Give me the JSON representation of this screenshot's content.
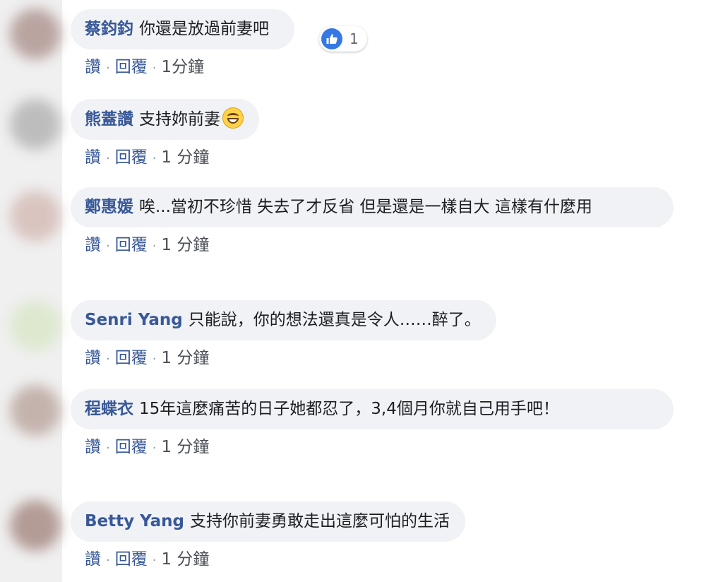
{
  "actions": {
    "like": "讚",
    "reply": "回覆",
    "separator": "·"
  },
  "comments": [
    {
      "name": "蔡鈞鈞",
      "text": "你還是放過前妻吧",
      "time": "1分鐘",
      "reaction_count": "1"
    },
    {
      "name": "熊蓋讚",
      "text": "支持妳前妻",
      "time": "1 分鐘",
      "emoji": "grinning-face-emoji"
    },
    {
      "name": "鄭惠媛",
      "text": "唉...當初不珍惜 失去了才反省 但是還是一樣自大 這樣有什麼用",
      "time": "1 分鐘"
    },
    {
      "name": "Senri Yang",
      "text": "只能說，你的想法還真是令人……醉了。",
      "time": "1 分鐘"
    },
    {
      "name": "程蝶衣",
      "text": "15年這麼痛苦的日子她都忍了，3,4個月你就自己用手吧！",
      "time": "1 分鐘"
    },
    {
      "name": "Betty Yang",
      "text": "支持你前妻勇敢走出這麼可怕的生活",
      "time": "1 分鐘"
    }
  ],
  "colors": {
    "bubble": "#f0f2f5",
    "name": "#385898",
    "action": "#385898",
    "like_badge": "#3578e5"
  }
}
